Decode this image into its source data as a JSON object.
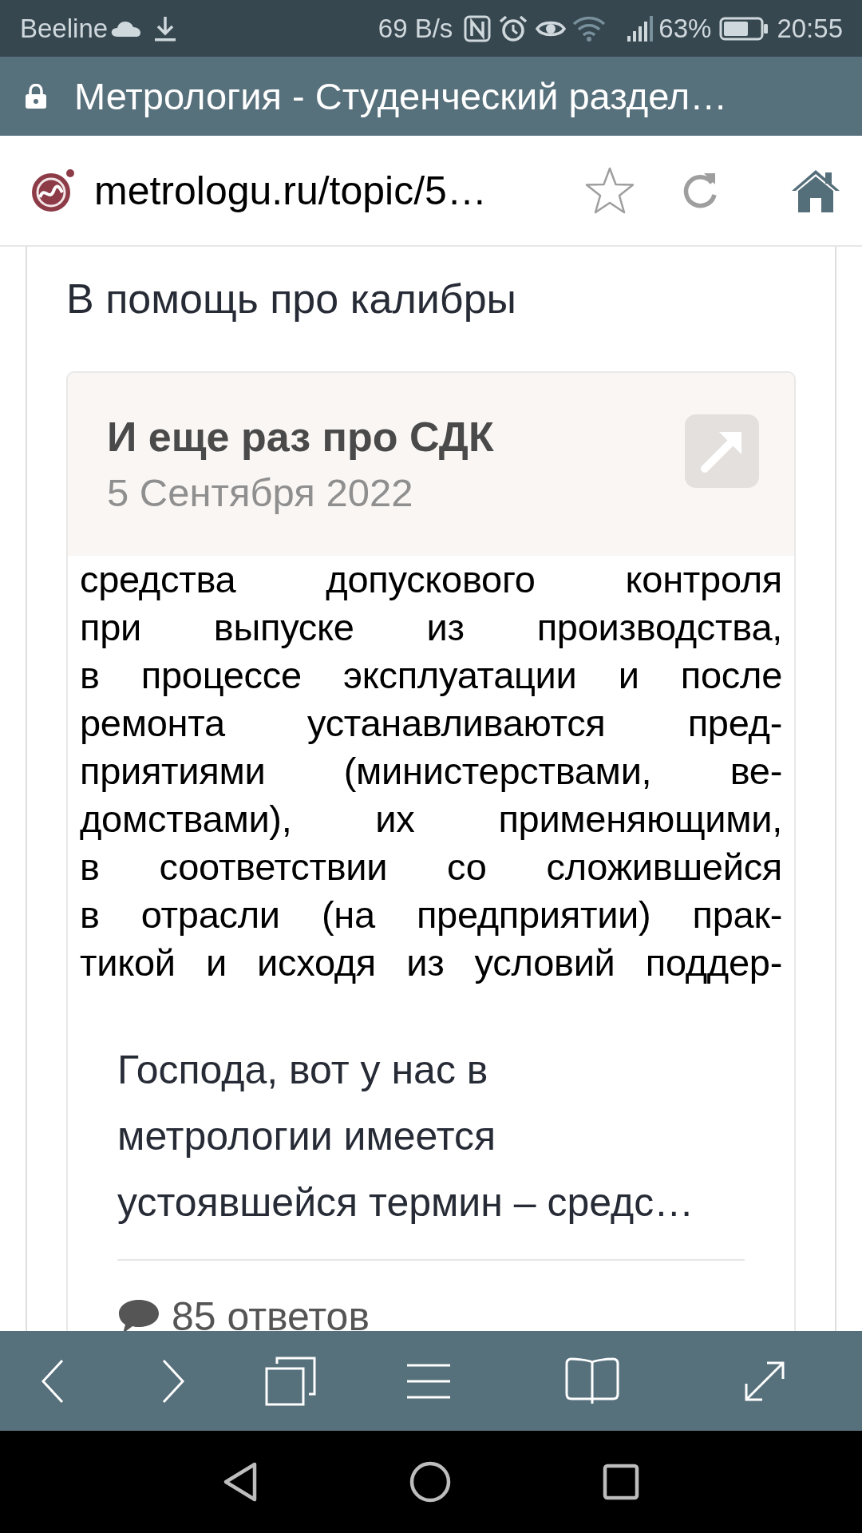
{
  "status_bar": {
    "carrier": "Beeline",
    "speed": "69 B/s",
    "battery": "63%",
    "time": "20:55"
  },
  "title_bar": {
    "title": "Метрология - Студенческий раздел…"
  },
  "address_bar": {
    "url": "metrologu.ru/topic/5…",
    "bookmarked": false
  },
  "section": {
    "title": "В помощь про калибры"
  },
  "topic_card": {
    "title": "И еще раз про СДК",
    "date": "5 Сентября 2022",
    "scan_lines": [
      "средства допускового контроля",
      "при выпуске из производства,",
      "в процессе эксплуатации и после",
      "ремонта устанавливаются пред-",
      "приятиями (министерствами, ве-",
      "домствами), их применяющими,",
      "в соответствии со сложившейся",
      "в отрасли (на предприятии) прак-",
      "тикой и исходя из условий поддер-"
    ],
    "excerpt_lines": [
      "Господа, вот у нас в",
      "метрологии имеется",
      "устоявшейся термин – средс…"
    ],
    "replies": "85 ответов"
  }
}
